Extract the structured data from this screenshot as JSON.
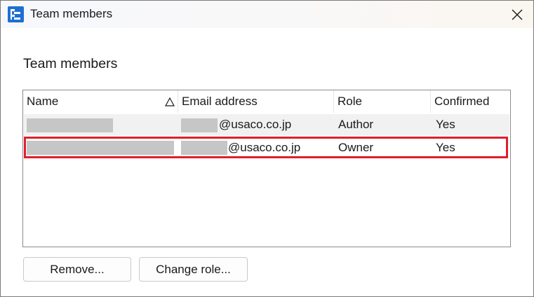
{
  "window": {
    "title": "Team members",
    "icon": "team-app-icon",
    "close_icon": "close-icon"
  },
  "heading": "Team members",
  "table": {
    "columns": [
      {
        "key": "name",
        "label": "Name",
        "sort_indicator": "△"
      },
      {
        "key": "email",
        "label": "Email address"
      },
      {
        "key": "role",
        "label": "Role"
      },
      {
        "key": "confirmed",
        "label": "Confirmed"
      }
    ],
    "rows": [
      {
        "name": "",
        "email_domain": "@usaco.co.jp",
        "role": "Author",
        "confirmed": "Yes"
      },
      {
        "name": "",
        "email_domain": "@usaco.co.jp",
        "role": "Owner",
        "confirmed": "Yes"
      }
    ],
    "highlighted_row": 1,
    "highlight_color": "#e01f2c",
    "alternate_row_color": "#f1f1f1"
  },
  "buttons": {
    "remove": "Remove...",
    "change_role": "Change role..."
  }
}
